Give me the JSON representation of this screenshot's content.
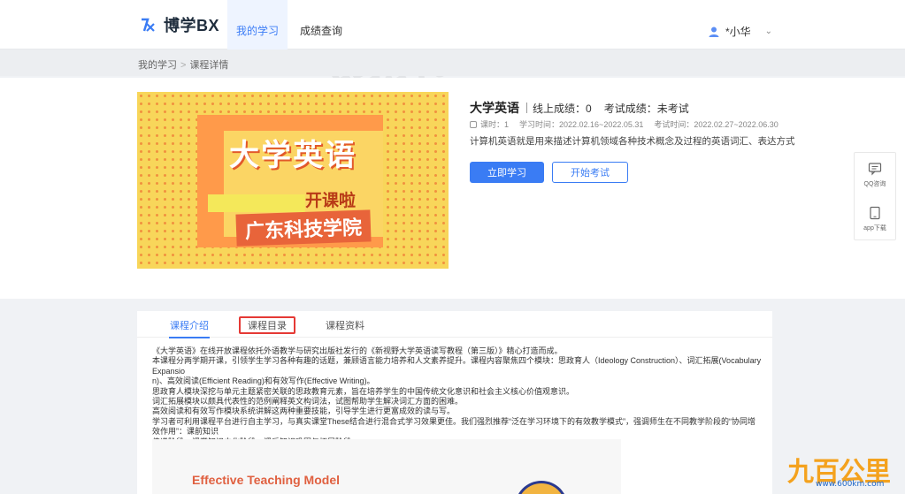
{
  "header": {
    "logo_text": "博学BX",
    "nav": [
      {
        "label": "我的学习",
        "active": true
      },
      {
        "label": "成绩查询",
        "active": false
      }
    ],
    "user_name": "*小华",
    "accent": "#3a7cf4"
  },
  "breadcrumb": {
    "items": [
      "我的学习",
      "课程详情"
    ]
  },
  "course": {
    "cover": {
      "title": "大学英语",
      "subtitle": "开课啦",
      "school": "广东科技学院"
    },
    "name": "大学英语",
    "online_score": "线上成绩：0",
    "exam_score": "考试成绩：未考试",
    "hours": "课时：1",
    "study_time": "学习时间：2022.02.16~2022.05.31",
    "exam_time": "考试时间：2022.02.27~2022.06.30",
    "description": "计算机英语就是用来描述计算机领域各种技术概念及过程的英语词汇、表达方式",
    "study_button": "立即学习",
    "exam_button": "开始考试"
  },
  "float_panel": {
    "qq": "QQ咨询",
    "app": "app下载"
  },
  "tabs": [
    {
      "label": "课程介绍",
      "active": true
    },
    {
      "label": "课程目录",
      "active": false,
      "highlighted": true
    },
    {
      "label": "课程资料",
      "active": false
    }
  ],
  "intro": [
    "《大学英语》在线开放课程依托外语教学与研究出版社发行的《新视野大学英语读写教程（第三版）》精心打造而成。",
    "本课程分两学期开课，引领学生学习各种有趣的话题，兼顾语言能力培养和人文素养提升。课程内容聚焦四个模块：思政育人（Ideology Construction）、词汇拓展(Vocabulary Expansio",
    "n)、高效阅读(Efficient Reading)和有效写作(Effective Writing)。",
    "思政育人模块深挖与单元主题紧密关联的思政教育元素，旨在培养学生的中国传统文化意识和社会主义核心价值观意识。",
    "词汇拓展模块以颇具代表性的范例阐释英文构词法，试图帮助学生解决词汇方面的困难。",
    "高效阅读和有效写作模块系统讲解这两种重要技能，引导学生进行更富成效的读与写。",
    "学习者可利用课程平台进行自主学习，与真实课堂These结合进行混合式学习效果更佳。我们强烈推荐“泛在学习环境下的有效教学模式”，强调师生在不同教学阶段的“协同增效作用”：课前知识",
    "传递阶段、课堂知识内化阶段、课后知识巩固与拓展阶段。"
  ],
  "illustration_title": "Effective Teaching Model",
  "watermark": "博思",
  "corner_badge": {
    "text": "百公里",
    "url": "www.600km.com"
  }
}
